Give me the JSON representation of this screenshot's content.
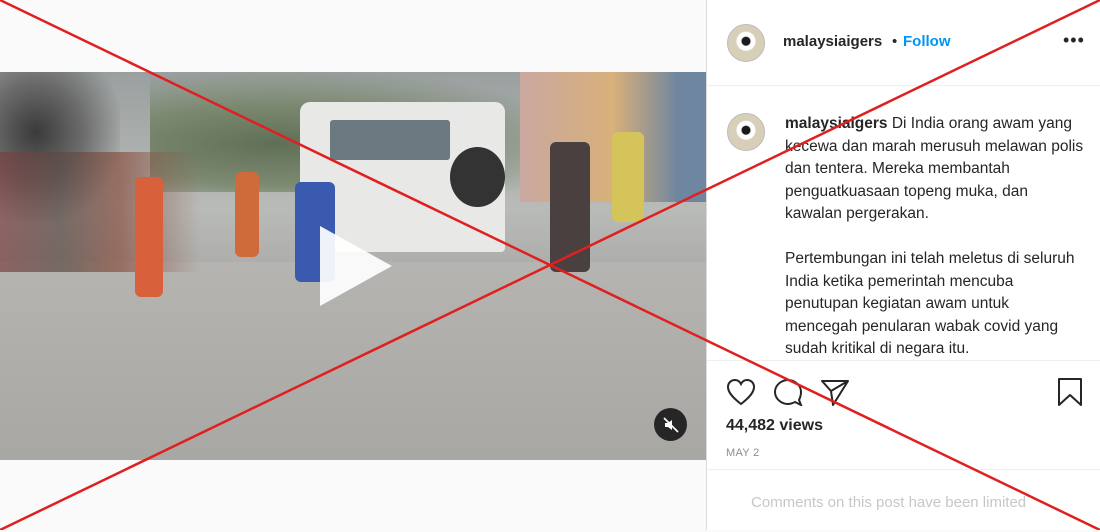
{
  "post": {
    "username": "malaysiaigers",
    "dot": "•",
    "follow_label": "Follow",
    "more_icon": "•••",
    "caption_user": "malaysiaigers",
    "caption_p1": "Di India orang awam yang kecewa dan marah merusuh melawan polis dan tentera. Mereka membantah penguatkuasaan topeng muka, dan kawalan pergerakan.",
    "caption_p2": "Pertembungan ini telah meletus di seluruh India ketika pemerintah mencuba penutupan kegiatan awam untuk mencegah penularan wabak covid yang sudah kritikal di negara itu.",
    "views": "44,482 views",
    "date": "MAY 2",
    "comments_notice": "Comments on this post have been limited"
  },
  "colors": {
    "accent": "#0095f6",
    "overlay_cross": "#e02020"
  },
  "icons": {
    "play": "play-icon",
    "mute": "muted-speaker-icon",
    "like": "heart-icon",
    "comment": "comment-bubble-icon",
    "share": "paper-plane-icon",
    "save": "bookmark-icon"
  }
}
